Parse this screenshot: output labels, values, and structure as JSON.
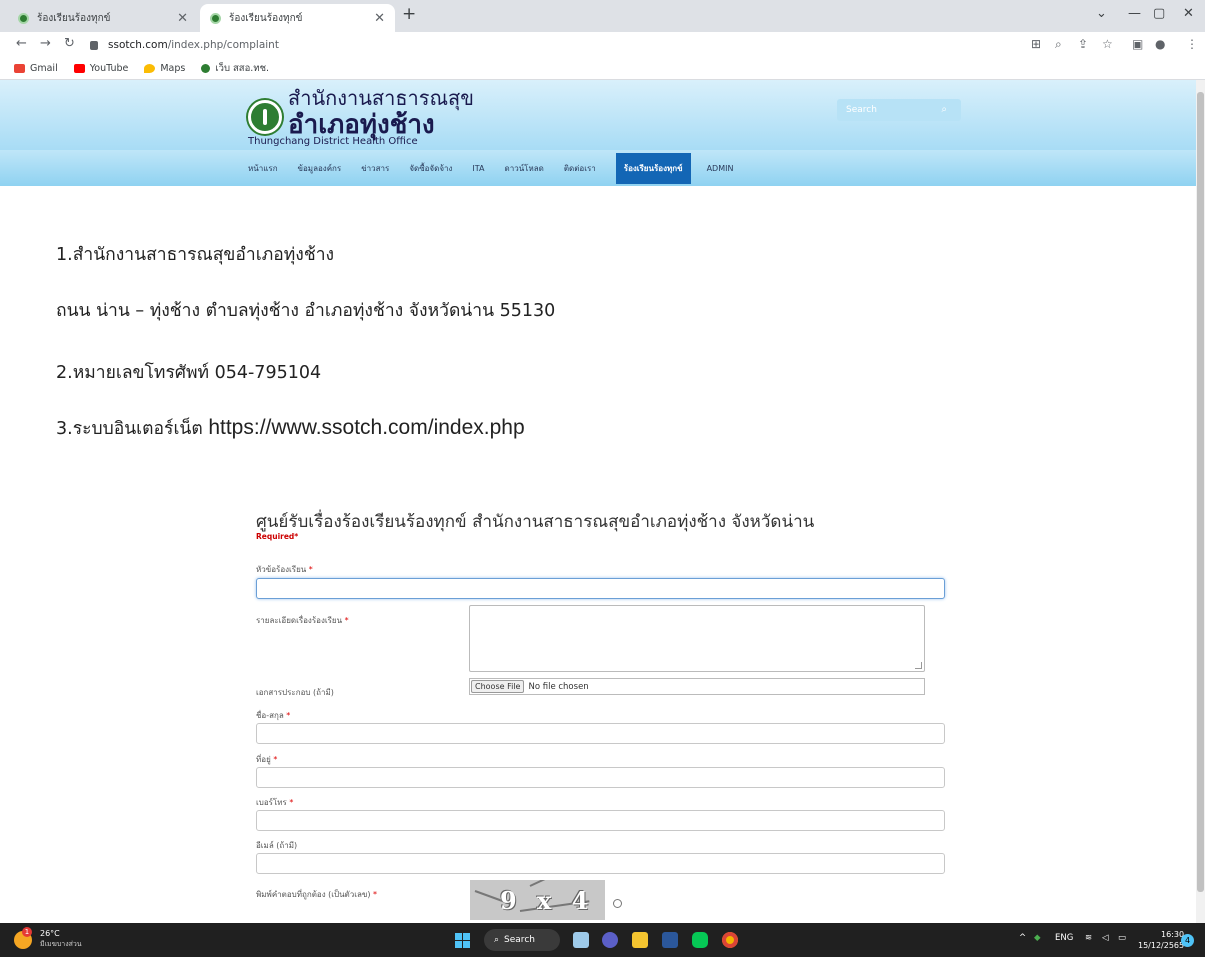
{
  "browser": {
    "tabs": [
      {
        "title": "ร้องเรียนร้องทุกข์"
      },
      {
        "title": "ร้องเรียนร้องทุกข์"
      }
    ],
    "url_host": "ssotch.com",
    "url_path": "/index.php/complaint",
    "bookmarks": [
      {
        "label": "Gmail",
        "color": "#ea4335"
      },
      {
        "label": "YouTube",
        "color": "#ff0000"
      },
      {
        "label": "Maps",
        "color": "#fbbc04"
      },
      {
        "label": "เว็บ สสอ.ทช.",
        "color": "#2e7d32"
      }
    ]
  },
  "site": {
    "logo_line1": "สำนักงานสาธารณสุข",
    "logo_line2": "อำเภอทุ่งช้าง",
    "logo_line3": "Thungchang District Health Office",
    "search_placeholder": "Search",
    "nav": [
      {
        "label": "หน้าแรก",
        "active": false
      },
      {
        "label": "ข้อมูลองค์กร",
        "active": false
      },
      {
        "label": "ข่าวสาร",
        "active": false
      },
      {
        "label": "จัดซื้อจัดจ้าง",
        "active": false
      },
      {
        "label": "ITA",
        "active": false
      },
      {
        "label": "ดาวน์โหลด",
        "active": false
      },
      {
        "label": "ติดต่อเรา",
        "active": false
      },
      {
        "label": "ร้องเรียนร้องทุกข์",
        "active": true
      },
      {
        "label": "ADMIN",
        "active": false
      }
    ],
    "accent_color": "#1366b5"
  },
  "content": {
    "line1": "1.สำนักงานสาธารณสุขอำเภอทุ่งช้าง",
    "line2": "ถนน น่าน – ทุ่งช้าง  ตำบลทุ่งช้าง  อำเภอทุ่งช้าง  จังหวัดน่าน  55130",
    "line3": "2.หมายเลขโทรศัพท์  054-795104",
    "line4_prefix": "3.ระบบอินเตอร์เน็ต ",
    "line4_url": "https://www.ssotch.com/index.php"
  },
  "form": {
    "title": "ศูนย์รับเรื่องร้องเรียนร้องทุกข์ สำนักงานสาธารณสุขอำเภอทุ่งช้าง จังหวัดน่าน",
    "required_note": "Required*",
    "required_star": "*",
    "fields": {
      "subject": "หัวข้อร้องเรียน",
      "detail": "รายละเอียดเรื่องร้องเรียน",
      "attachment": "เอกสารประกอบ (ถ้ามี)",
      "name": "ชื่อ-สกุล",
      "address": "ที่อยู่",
      "phone": "เบอร์โทร",
      "email": "อีเมล์ (ถ้ามี)",
      "captcha": "พิมพ์คำตอบที่ถูกต้อง (เป็นตัวเลข)"
    },
    "choose_file_label": "Choose File",
    "no_file_text": "No file chosen",
    "captcha_text": "9 x 4"
  },
  "taskbar": {
    "temperature": "26°C",
    "weather": "มีเมฆบางส่วน",
    "weather_badge": "1",
    "search_label": "Search",
    "language": "ENG",
    "time": "16:30",
    "date": "15/12/2565",
    "notifications": "4"
  }
}
